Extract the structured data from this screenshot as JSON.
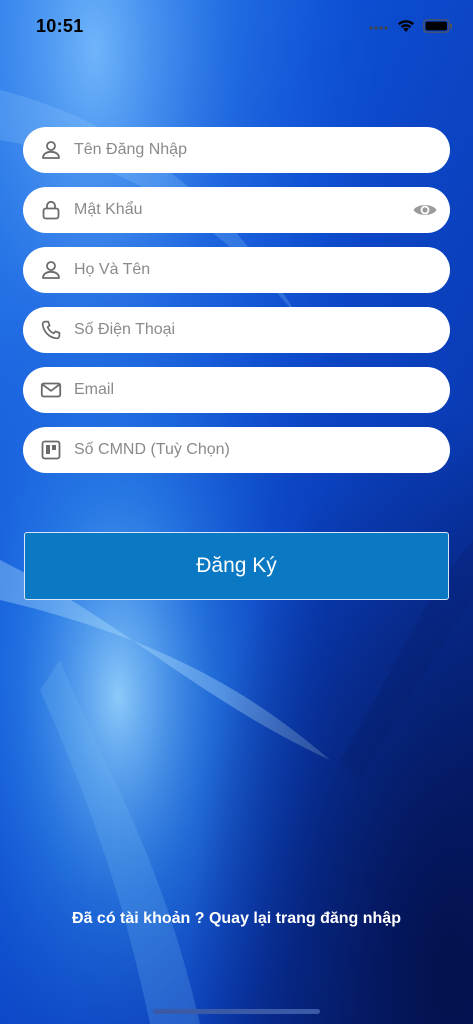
{
  "status_bar": {
    "time": "10:51"
  },
  "form": {
    "fields": [
      {
        "name": "username",
        "placeholder": "Tên Đăng Nhập",
        "icon": "user-icon"
      },
      {
        "name": "password",
        "placeholder": "Mật Khẩu",
        "icon": "lock-icon",
        "trailing_icon": "eye-icon"
      },
      {
        "name": "fullname",
        "placeholder": "Họ Và Tên",
        "icon": "user-icon"
      },
      {
        "name": "phone",
        "placeholder": "Số Điện Thoại",
        "icon": "phone-icon"
      },
      {
        "name": "email",
        "placeholder": "Email",
        "icon": "mail-icon"
      },
      {
        "name": "id_card",
        "placeholder": "Số CMND (Tuỳ Chọn)",
        "icon": "id-card-icon"
      }
    ]
  },
  "register_button": {
    "label": "Đăng Ký"
  },
  "login_link": {
    "label": "Đã có tài khoản ? Quay lại trang đăng nhập"
  },
  "colors": {
    "background": "#0a3ec0",
    "button": "#0a78c2",
    "field": "#ffffff",
    "icon": "#6b6b6b"
  }
}
